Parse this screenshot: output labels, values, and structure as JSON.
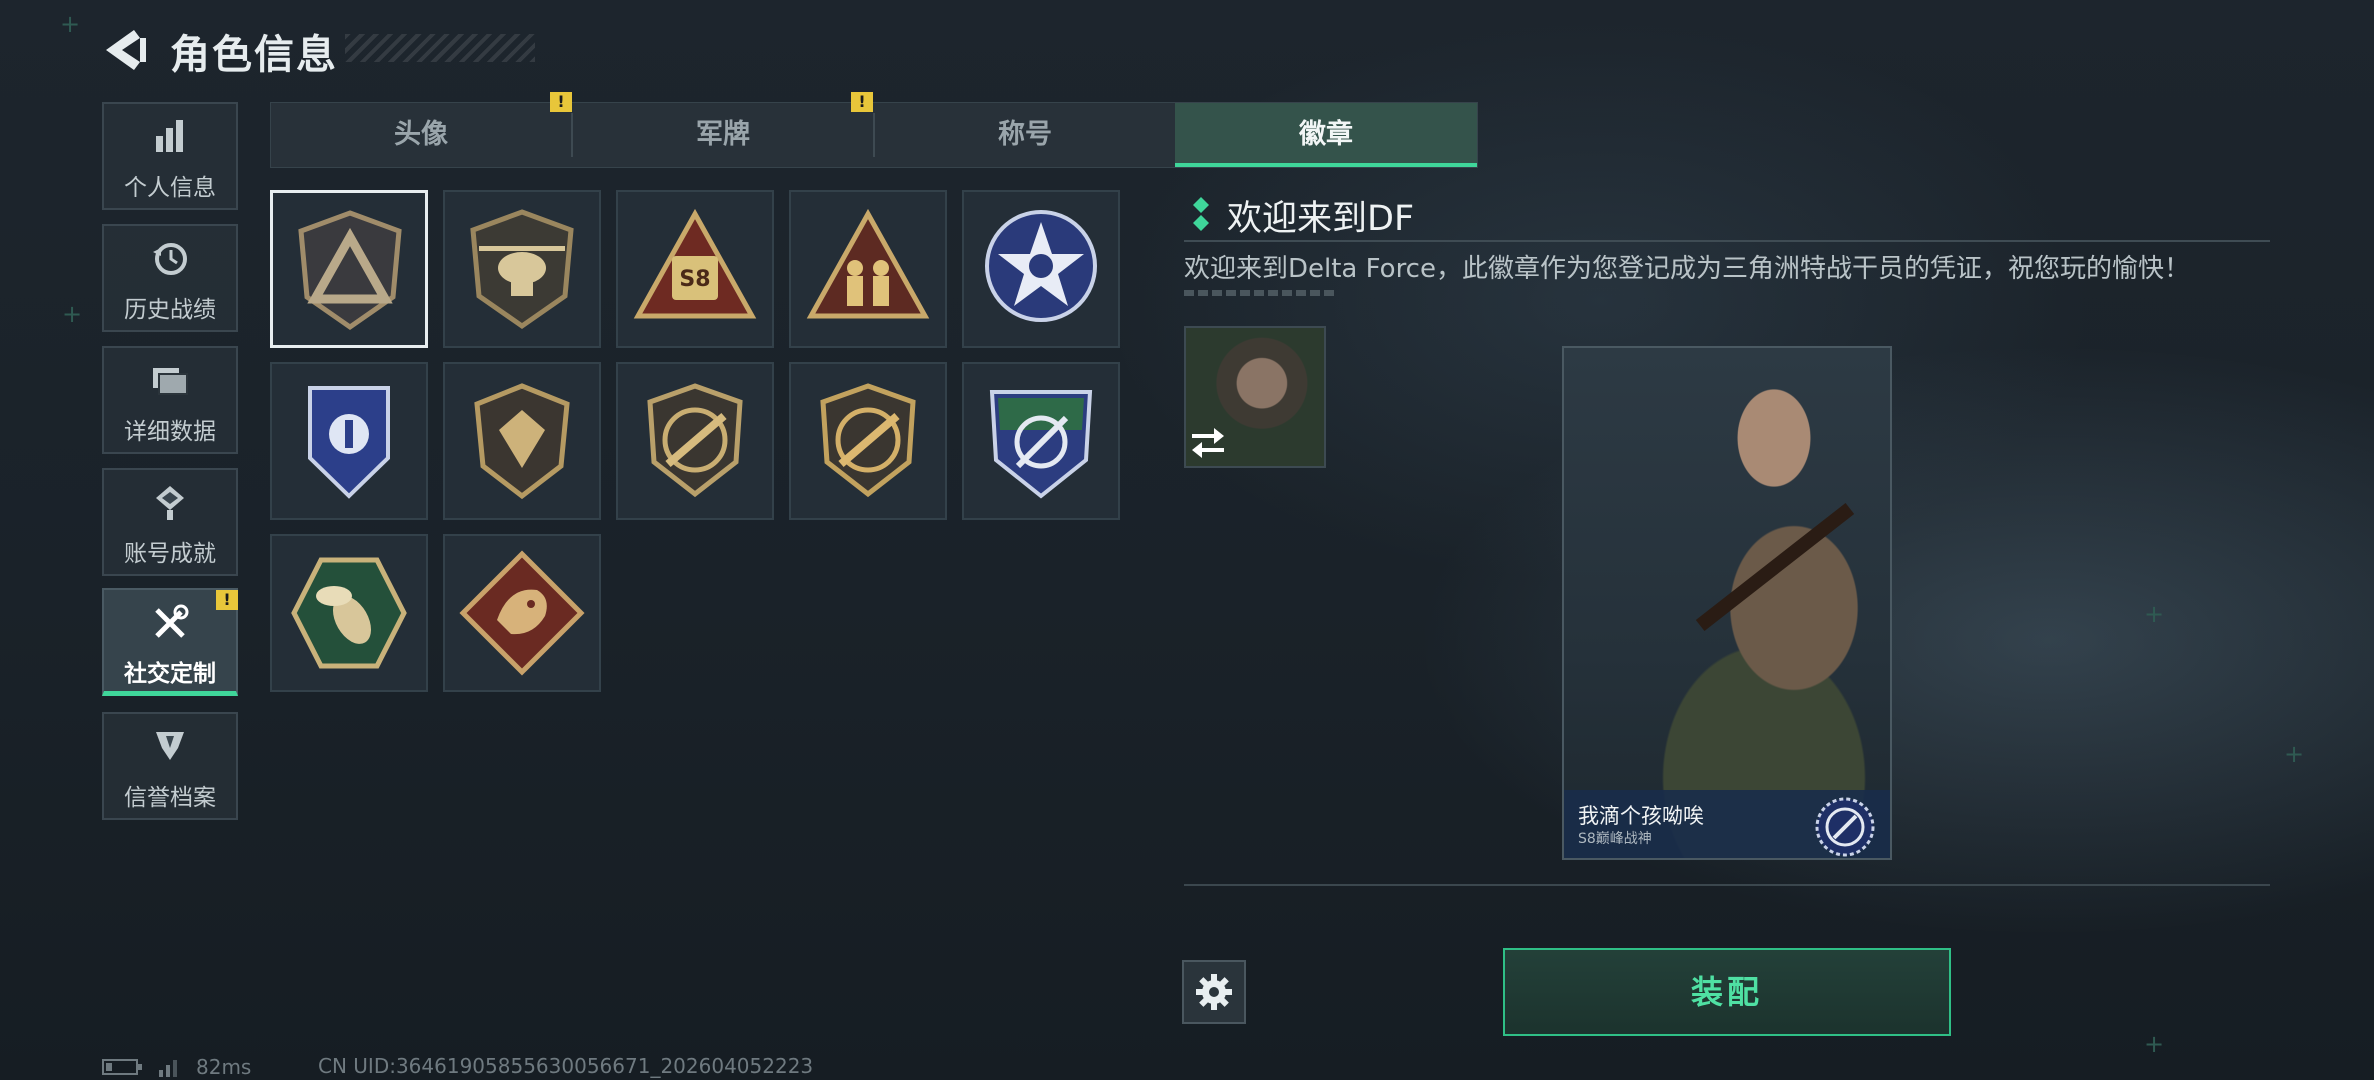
{
  "header": {
    "title": "角色信息"
  },
  "nav": {
    "items": [
      {
        "label": "个人信息",
        "icon": "bar-chart-icon"
      },
      {
        "label": "历史战绩",
        "icon": "history-icon"
      },
      {
        "label": "详细数据",
        "icon": "folder-icon"
      },
      {
        "label": "账号成就",
        "icon": "achievement-icon"
      },
      {
        "label": "社交定制",
        "icon": "tools-icon",
        "active": true,
        "badge": "!"
      },
      {
        "label": "信誉档案",
        "icon": "reputation-icon"
      }
    ]
  },
  "tabs": [
    {
      "label": "头像",
      "badge": "!"
    },
    {
      "label": "军牌",
      "badge": "!"
    },
    {
      "label": "称号"
    },
    {
      "label": "徽章",
      "active": true
    }
  ],
  "badges": [
    {
      "name": "delta-triangle-badge",
      "selected": true
    },
    {
      "name": "helicopter-badge"
    },
    {
      "name": "s8-triangle-badge",
      "text": "S8"
    },
    {
      "name": "soldiers-triangle-badge"
    },
    {
      "name": "star-blue-badge"
    },
    {
      "name": "blue-wings-badge"
    },
    {
      "name": "gem-shield-badge"
    },
    {
      "name": "rifle-badge-1"
    },
    {
      "name": "rifle-badge-2"
    },
    {
      "name": "green-scope-badge"
    },
    {
      "name": "bee-badge"
    },
    {
      "name": "dragon-badge"
    }
  ],
  "detail": {
    "title": "欢迎来到DF",
    "description": "欢迎来到Delta Force，此徽章作为您登记成为三角洲特战干员的凭证，祝您玩的愉快！"
  },
  "card": {
    "player_name": "我滴个孩呦唉",
    "subtitle": "S8巅峰战神"
  },
  "buttons": {
    "equip": "装配"
  },
  "status": {
    "ping": "82ms",
    "uid": "CN UID:3646190585563005667​1_202604052223"
  },
  "colors": {
    "accent": "#3fd69a",
    "badge_alert": "#e8c63a"
  }
}
